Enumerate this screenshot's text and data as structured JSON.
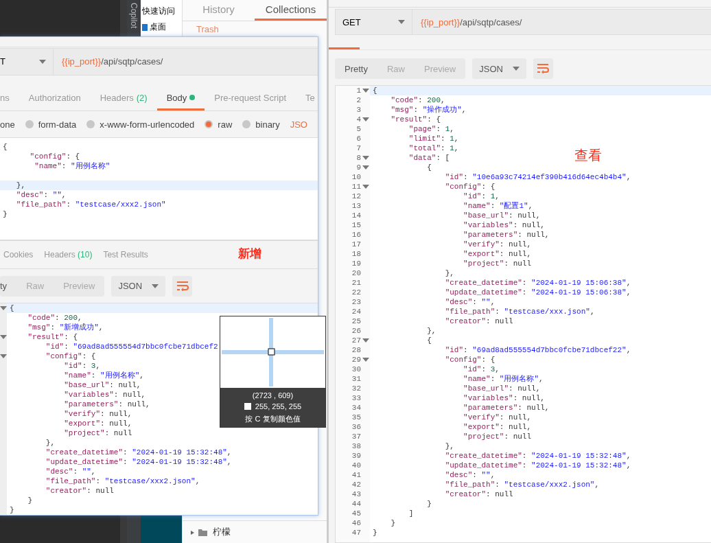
{
  "desktop": {
    "copilot_label": "Copilot",
    "explorer_items": [
      {
        "label": "快速访问",
        "icon": false
      },
      {
        "label": "桌面",
        "icon": true
      }
    ]
  },
  "back_panel": {
    "tabs": [
      {
        "label": "History",
        "selected": false
      },
      {
        "label": "Collections",
        "selected": true
      }
    ],
    "trash_label": "Trash",
    "folder_label": "柠檬"
  },
  "main_window": {
    "method": "GET",
    "url_variable": "{{ip_port}}",
    "url_path": "/api/sqtp/cases/",
    "view_modes": [
      {
        "label": "Pretty",
        "selected": true
      },
      {
        "label": "Raw",
        "selected": false
      },
      {
        "label": "Preview",
        "selected": false
      }
    ],
    "format": "JSON",
    "annotation": "查看",
    "response_lines": [
      {
        "n": "1",
        "fold": true,
        "current": true,
        "text": "{"
      },
      {
        "n": "2",
        "fold": false,
        "current": false,
        "text": "    \"code\": 200,"
      },
      {
        "n": "3",
        "fold": false,
        "current": false,
        "text": "    \"msg\": \"操作成功\","
      },
      {
        "n": "4",
        "fold": true,
        "current": false,
        "text": "    \"result\": {"
      },
      {
        "n": "5",
        "fold": false,
        "current": false,
        "text": "        \"page\": 1,"
      },
      {
        "n": "6",
        "fold": false,
        "current": false,
        "text": "        \"limit\": 1,"
      },
      {
        "n": "7",
        "fold": false,
        "current": false,
        "text": "        \"total\": 1,"
      },
      {
        "n": "8",
        "fold": true,
        "current": false,
        "text": "        \"data\": ["
      },
      {
        "n": "9",
        "fold": true,
        "current": false,
        "text": "            {"
      },
      {
        "n": "10",
        "fold": false,
        "current": false,
        "text": "                \"id\": \"10e6a93c74214ef390b416d64ec4b4b4\","
      },
      {
        "n": "11",
        "fold": true,
        "current": false,
        "text": "                \"config\": {"
      },
      {
        "n": "12",
        "fold": false,
        "current": false,
        "text": "                    \"id\": 1,"
      },
      {
        "n": "13",
        "fold": false,
        "current": false,
        "text": "                    \"name\": \"配置1\","
      },
      {
        "n": "14",
        "fold": false,
        "current": false,
        "text": "                    \"base_url\": null,"
      },
      {
        "n": "15",
        "fold": false,
        "current": false,
        "text": "                    \"variables\": null,"
      },
      {
        "n": "16",
        "fold": false,
        "current": false,
        "text": "                    \"parameters\": null,"
      },
      {
        "n": "17",
        "fold": false,
        "current": false,
        "text": "                    \"verify\": null,"
      },
      {
        "n": "18",
        "fold": false,
        "current": false,
        "text": "                    \"export\": null,"
      },
      {
        "n": "19",
        "fold": false,
        "current": false,
        "text": "                    \"project\": null"
      },
      {
        "n": "20",
        "fold": false,
        "current": false,
        "text": "                },"
      },
      {
        "n": "21",
        "fold": false,
        "current": false,
        "text": "                \"create_datetime\": \"2024-01-19 15:06:38\","
      },
      {
        "n": "22",
        "fold": false,
        "current": false,
        "text": "                \"update_datetime\": \"2024-01-19 15:06:38\","
      },
      {
        "n": "23",
        "fold": false,
        "current": false,
        "text": "                \"desc\": \"\","
      },
      {
        "n": "24",
        "fold": false,
        "current": false,
        "text": "                \"file_path\": \"testcase/xxx.json\","
      },
      {
        "n": "25",
        "fold": false,
        "current": false,
        "text": "                \"creator\": null"
      },
      {
        "n": "26",
        "fold": false,
        "current": false,
        "text": "            },"
      },
      {
        "n": "27",
        "fold": true,
        "current": false,
        "text": "            {"
      },
      {
        "n": "28",
        "fold": false,
        "current": false,
        "text": "                \"id\": \"69ad8ad555554d7bbc0fcbe71dbcef22\","
      },
      {
        "n": "29",
        "fold": true,
        "current": false,
        "text": "                \"config\": {"
      },
      {
        "n": "30",
        "fold": false,
        "current": false,
        "text": "                    \"id\": 3,"
      },
      {
        "n": "31",
        "fold": false,
        "current": false,
        "text": "                    \"name\": \"用例名称\","
      },
      {
        "n": "32",
        "fold": false,
        "current": false,
        "text": "                    \"base_url\": null,"
      },
      {
        "n": "33",
        "fold": false,
        "current": false,
        "text": "                    \"variables\": null,"
      },
      {
        "n": "34",
        "fold": false,
        "current": false,
        "text": "                    \"parameters\": null,"
      },
      {
        "n": "35",
        "fold": false,
        "current": false,
        "text": "                    \"verify\": null,"
      },
      {
        "n": "36",
        "fold": false,
        "current": false,
        "text": "                    \"export\": null,"
      },
      {
        "n": "37",
        "fold": false,
        "current": false,
        "text": "                    \"project\": null"
      },
      {
        "n": "38",
        "fold": false,
        "current": false,
        "text": "                },"
      },
      {
        "n": "39",
        "fold": false,
        "current": false,
        "text": "                \"create_datetime\": \"2024-01-19 15:32:48\","
      },
      {
        "n": "40",
        "fold": false,
        "current": false,
        "text": "                \"update_datetime\": \"2024-01-19 15:32:48\","
      },
      {
        "n": "41",
        "fold": false,
        "current": false,
        "text": "                \"desc\": \"\","
      },
      {
        "n": "42",
        "fold": false,
        "current": false,
        "text": "                \"file_path\": \"testcase/xxx2.json\","
      },
      {
        "n": "43",
        "fold": false,
        "current": false,
        "text": "                \"creator\": null"
      },
      {
        "n": "44",
        "fold": false,
        "current": false,
        "text": "            }"
      },
      {
        "n": "45",
        "fold": false,
        "current": false,
        "text": "        ]"
      },
      {
        "n": "46",
        "fold": false,
        "current": false,
        "text": "    }"
      },
      {
        "n": "47",
        "fold": false,
        "current": false,
        "text": "}"
      }
    ]
  },
  "request_window": {
    "method": "T",
    "url_variable": "{{ip_port}}",
    "url_path": "/api/sqtp/cases/",
    "request_tabs": [
      {
        "label": "ns",
        "dot": false,
        "selected": false
      },
      {
        "label": "Authorization",
        "dot": false,
        "selected": false
      },
      {
        "label": "Headers",
        "count": "(2)",
        "dot": false,
        "selected": false
      },
      {
        "label": "Body",
        "dot": true,
        "selected": true
      },
      {
        "label": "Pre-request Script",
        "dot": false,
        "selected": false
      },
      {
        "label": "Te",
        "dot": false,
        "selected": false
      }
    ],
    "body_types": [
      {
        "label": "one",
        "radio": false
      },
      {
        "label": "form-data",
        "radio": true,
        "selected": false
      },
      {
        "label": "x-www-form-urlencoded",
        "radio": true,
        "selected": false
      },
      {
        "label": "raw",
        "radio": true,
        "selected": true
      },
      {
        "label": "binary",
        "radio": true,
        "selected": false
      }
    ],
    "body_format": "JSO",
    "body_lines": [
      {
        "current": false,
        "text": "{"
      },
      {
        "current": false,
        "text": "      \"config\": {"
      },
      {
        "current": false,
        "text": "       \"name\": \"用例名称\""
      },
      {
        "current": false
      },
      {
        "current": true,
        "text": "   },"
      },
      {
        "current": false,
        "text": "   \"desc\": \"\","
      },
      {
        "current": false,
        "text": "   \"file_path\": \"testcase/xxx2.json\""
      },
      {
        "current": false,
        "text": "}"
      }
    ],
    "response_tabs": [
      {
        "label": "Cookies"
      },
      {
        "label": "Headers",
        "count": "(10)"
      },
      {
        "label": "Test Results"
      }
    ],
    "annotation": "新增",
    "view_modes": [
      {
        "label": "ty",
        "selected": true
      },
      {
        "label": "Raw",
        "selected": false
      },
      {
        "label": "Preview",
        "selected": false
      }
    ],
    "format": "JSON",
    "response_lines": [
      {
        "fold": true,
        "current": true,
        "text": "{"
      },
      {
        "fold": false,
        "current": false,
        "text": "    \"code\": 200,"
      },
      {
        "fold": false,
        "current": false,
        "text": "    \"msg\": \"新增成功\","
      },
      {
        "fold": true,
        "current": false,
        "text": "    \"result\": {"
      },
      {
        "fold": false,
        "current": false,
        "text": "        \"id\": \"69ad8ad555554d7bbc0fcbe71dbcef2"
      },
      {
        "fold": true,
        "current": false,
        "text": "        \"config\": {"
      },
      {
        "fold": false,
        "current": false,
        "text": "            \"id\": 3,"
      },
      {
        "fold": false,
        "current": false,
        "text": "            \"name\": \"用例名称\","
      },
      {
        "fold": false,
        "current": false,
        "text": "            \"base_url\": null,"
      },
      {
        "fold": false,
        "current": false,
        "text": "            \"variables\": null,"
      },
      {
        "fold": false,
        "current": false,
        "text": "            \"parameters\": null,"
      },
      {
        "fold": false,
        "current": false,
        "text": "            \"verify\": null,"
      },
      {
        "fold": false,
        "current": false,
        "text": "            \"export\": null,"
      },
      {
        "fold": false,
        "current": false,
        "text": "            \"project\": null"
      },
      {
        "fold": false,
        "current": false,
        "text": "        },"
      },
      {
        "fold": false,
        "current": false,
        "text": "        \"create_datetime\": \"2024-01-19 15:32:48\","
      },
      {
        "fold": false,
        "current": false,
        "text": "        \"update_datetime\": \"2024-01-19 15:32:48\","
      },
      {
        "fold": false,
        "current": false,
        "text": "        \"desc\": \"\","
      },
      {
        "fold": false,
        "current": false,
        "text": "        \"file_path\": \"testcase/xxx2.json\","
      },
      {
        "fold": false,
        "current": false,
        "text": "        \"creator\": null"
      },
      {
        "fold": false,
        "current": false,
        "text": "    }"
      },
      {
        "fold": false,
        "current": false,
        "text": "}"
      }
    ]
  },
  "color_picker": {
    "coordinates": "(2723 , 609)",
    "rgb": "255, 255, 255",
    "hint": "按 C 复制颜色值"
  }
}
